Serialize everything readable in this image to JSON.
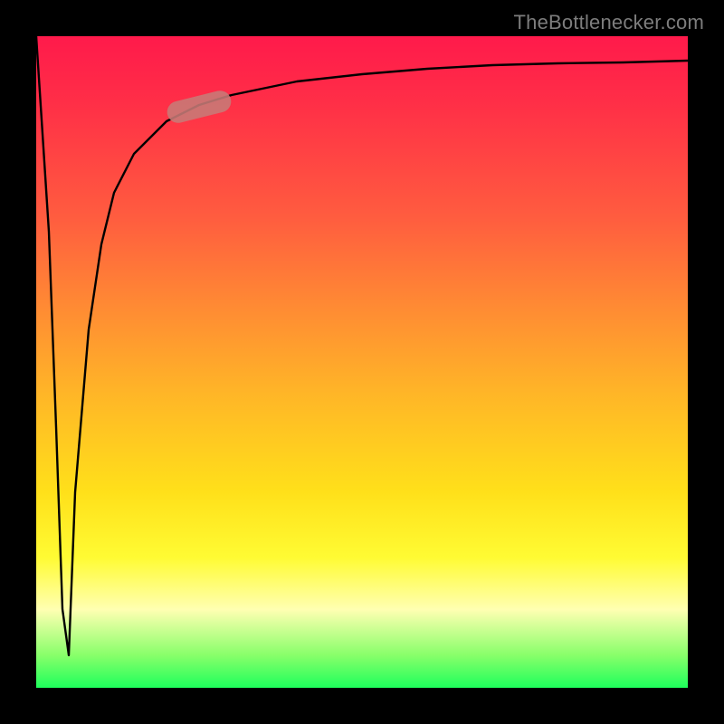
{
  "attribution": "TheBottlenecker.com",
  "colors": {
    "background": "#000000",
    "gradient_top": "#ff1a4b",
    "gradient_mid": "#ffe01a",
    "gradient_bottom": "#1eff5c",
    "curve": "#000000",
    "marker": "#c77b78"
  },
  "chart_data": {
    "type": "line",
    "title": "",
    "xlabel": "",
    "ylabel": "",
    "xlim": [
      0,
      100
    ],
    "ylim": [
      0,
      100
    ],
    "series": [
      {
        "name": "curve",
        "x": [
          0,
          2,
          3,
          4,
          5,
          6,
          8,
          10,
          12,
          15,
          20,
          25,
          30,
          40,
          50,
          60,
          70,
          80,
          90,
          100
        ],
        "y": [
          100,
          70,
          40,
          12,
          5,
          30,
          55,
          68,
          76,
          82,
          87,
          89.5,
          91,
          93,
          94.2,
          95,
          95.5,
          95.8,
          96,
          96.2
        ]
      }
    ],
    "marker": {
      "x_range": [
        20,
        30
      ],
      "y_range": [
        87,
        91
      ]
    }
  }
}
